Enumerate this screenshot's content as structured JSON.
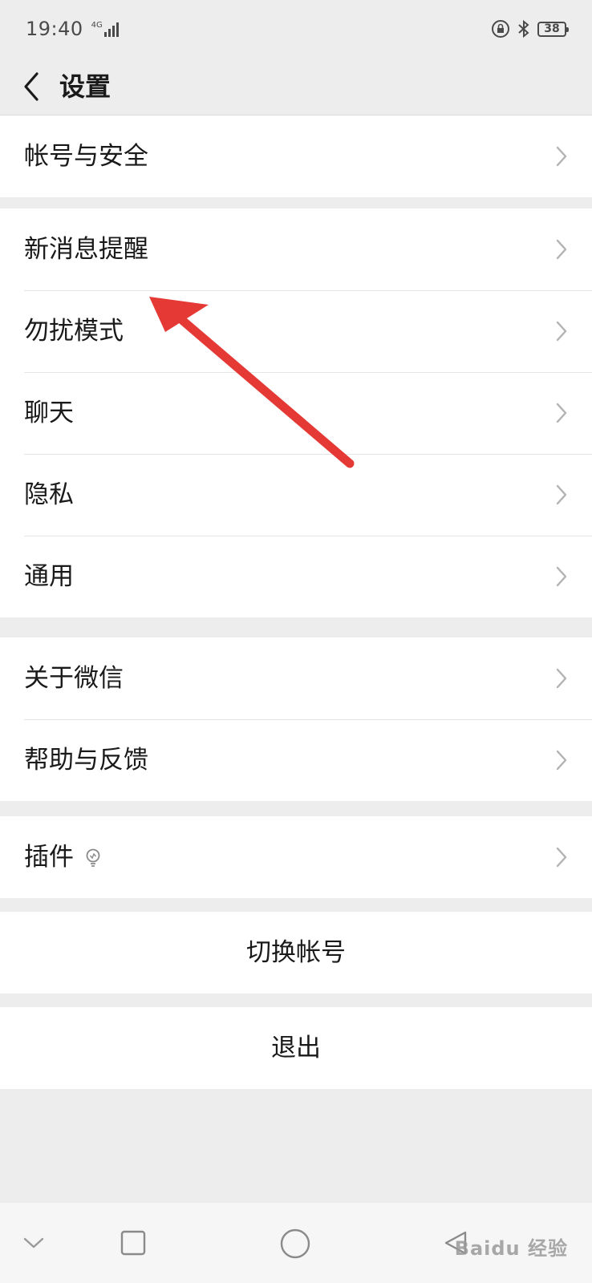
{
  "status_bar": {
    "time": "19:40",
    "network": "4G",
    "battery": "38"
  },
  "nav": {
    "title": "设置"
  },
  "menu": {
    "account_security": "帐号与安全",
    "new_message_alerts": "新消息提醒",
    "do_not_disturb": "勿扰模式",
    "chat": "聊天",
    "privacy": "隐私",
    "general": "通用",
    "about_wechat": "关于微信",
    "help_feedback": "帮助与反馈",
    "plugins": "插件",
    "switch_account": "切换帐号",
    "logout": "退出"
  },
  "watermark": "Baidu 经验",
  "colors": {
    "annotation_arrow": "#e53935",
    "background": "#ededed"
  }
}
